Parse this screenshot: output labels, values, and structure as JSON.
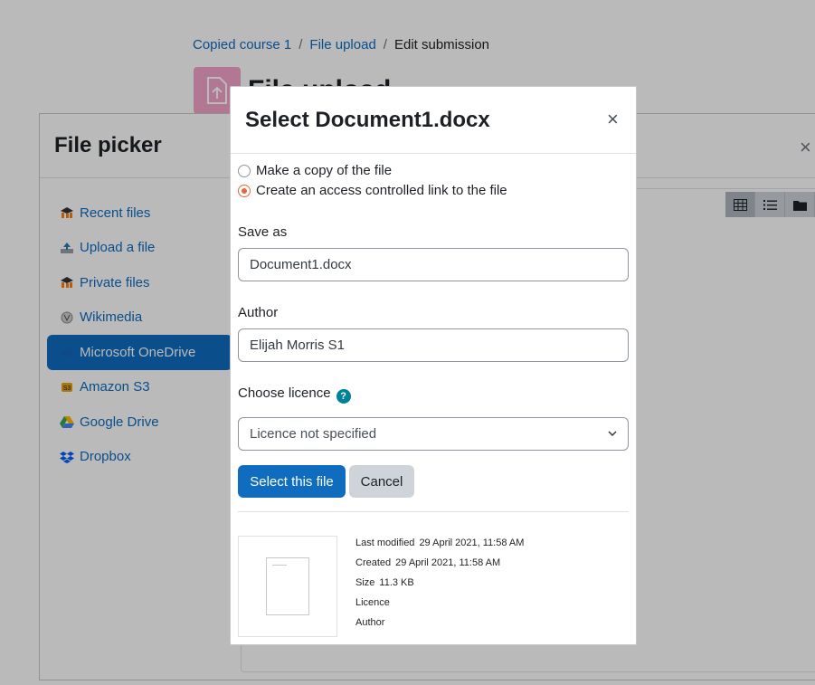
{
  "breadcrumb": {
    "items": [
      "Copied course 1",
      "File upload"
    ],
    "separator": "/",
    "current": "Edit submission"
  },
  "page": {
    "title": "File upload"
  },
  "file_picker": {
    "title": "File picker",
    "close": "×",
    "repositories": [
      {
        "label": "Recent files",
        "icon": "moodle-icon"
      },
      {
        "label": "Upload a file",
        "icon": "upload-icon"
      },
      {
        "label": "Private files",
        "icon": "moodle-icon"
      },
      {
        "label": "Wikimedia",
        "icon": "wikimedia-icon"
      },
      {
        "label": "Microsoft OneDrive",
        "icon": "onedrive-icon",
        "active": true
      },
      {
        "label": "Amazon S3",
        "icon": "amazon-s3-icon"
      },
      {
        "label": "Google Drive",
        "icon": "google-drive-icon"
      },
      {
        "label": "Dropbox",
        "icon": "dropbox-icon"
      }
    ],
    "view_buttons": [
      "grid-view-icon",
      "list-view-icon",
      "folder-view-icon"
    ]
  },
  "select_modal": {
    "title": "Select Document1.docx",
    "close": "×",
    "options": {
      "copy": "Make a copy of the file",
      "link": "Create an access controlled link to the file",
      "selected": "link"
    },
    "save_as": {
      "label": "Save as",
      "value": "Document1.docx"
    },
    "author": {
      "label": "Author",
      "value": "Elijah Morris S1"
    },
    "licence": {
      "label": "Choose licence",
      "help": "?",
      "selected": "Licence not specified"
    },
    "buttons": {
      "select": "Select this file",
      "cancel": "Cancel"
    },
    "details": {
      "last_modified_label": "Last modified",
      "last_modified": "29 April 2021, 11:58 AM",
      "created_label": "Created",
      "created": "29 April 2021, 11:58 AM",
      "size_label": "Size",
      "size": "11.3 KB",
      "licence_label": "Licence",
      "author_label": "Author"
    }
  },
  "colors": {
    "primary": "#0f6cbf",
    "radio_accent": "#e8663d",
    "help": "#008196",
    "activity_icon": "#f4a3c8"
  }
}
